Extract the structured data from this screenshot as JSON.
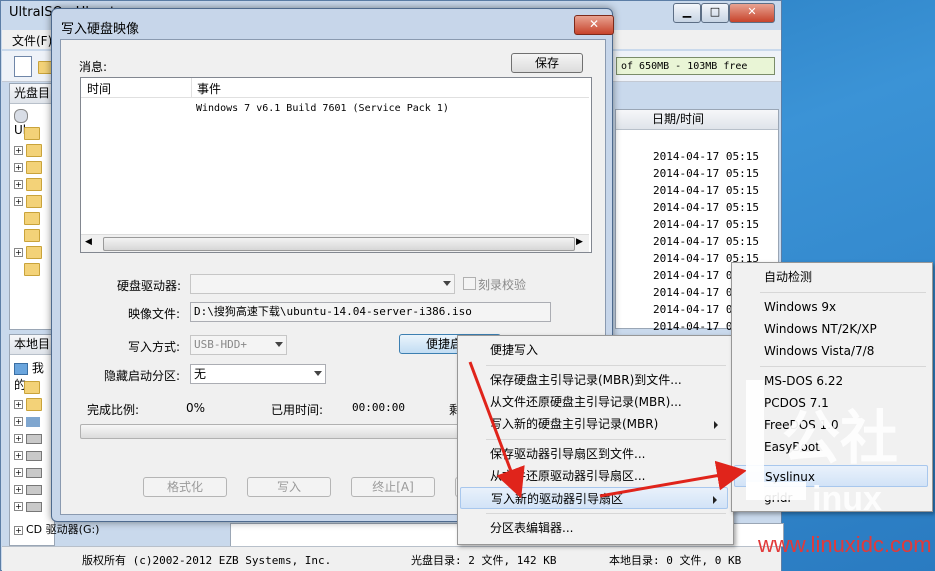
{
  "main_window": {
    "title": "UltraISO - Ubuntu",
    "menu_file": "文件(F)",
    "iso_info": "of 650MB - 103MB free",
    "cd_dir_label": "光盘目",
    "iso_root": "Ubu",
    "local_dir_label": "本地目",
    "local_root": "我的",
    "cd_drive": "CD 驱动器(G:)",
    "date_header": "日期/时间",
    "dates": [
      "2014-04-17 05:15",
      "2014-04-17 05:15",
      "2014-04-17 05:15",
      "2014-04-17 05:15",
      "2014-04-17 05:15",
      "2014-04-17 05:15",
      "2014-04-17 05:15",
      "2014-04-17 05:15",
      "2014-04-17 05:15",
      "2014-04-17 05",
      "2014-04-17 05",
      "2014-04-17 05"
    ],
    "status": {
      "copyright": "版权所有 (c)2002-2012 EZB Systems, Inc.",
      "cd_dir": "光盘目录: 2 文件, 142 KB",
      "local_dir": "本地目录: 0 文件, 0 KB"
    }
  },
  "dialog": {
    "title": "写入硬盘映像",
    "close_label": "✕",
    "messages_label": "消息:",
    "save_button": "保存",
    "col_time": "时间",
    "col_event": "事件",
    "log_event": "Windows 7 v6.1 Build 7601 (Service Pack 1)",
    "drive_label": "硬盘驱动器:",
    "drive_value": "",
    "verify_label": "刻录校验",
    "image_label": "映像文件:",
    "image_value": "D:\\搜狗高速下载\\ubuntu-14.04-server-i386.iso",
    "write_mode_label": "写入方式:",
    "write_mode_value": "USB-HDD+",
    "quick_boot_button": "便捷启动",
    "hide_partition_label": "隐藏启动分区:",
    "hide_partition_value": "无",
    "progress_label": "完成比例:",
    "progress_value": "0%",
    "elapsed_label": "已用时间:",
    "elapsed_value": "00:00:00",
    "remaining_label": "剩",
    "progress_fraction": 0,
    "buttons": {
      "format": "格式化",
      "write": "写入",
      "abort": "终止[A]"
    }
  },
  "context_menu": {
    "items": [
      "便捷写入",
      "保存硬盘主引导记录(MBR)到文件...",
      "从文件还原硬盘主引导记录(MBR)...",
      "写入新的硬盘主引导记录(MBR)",
      "保存驱动器引导扇区到文件...",
      "从文件还原驱动器引导扇区...",
      "写入新的驱动器引导扇区",
      "分区表编辑器..."
    ]
  },
  "submenu": {
    "items": [
      "自动检测",
      "Windows 9x",
      "Windows NT/2K/XP",
      "Windows Vista/7/8",
      "MS-DOS 6.22",
      "PCDOS 7.1",
      "FreeDOS 1.0",
      "EasyBoot",
      "Syslinux",
      "grldr"
    ]
  },
  "watermark": {
    "site": "www.linuxidc.com",
    "logo_text": "Linux公社"
  },
  "colors": {
    "highlight": "#d2e3f7",
    "arrow": "#e0241b",
    "watermark": "#e23a3a"
  }
}
